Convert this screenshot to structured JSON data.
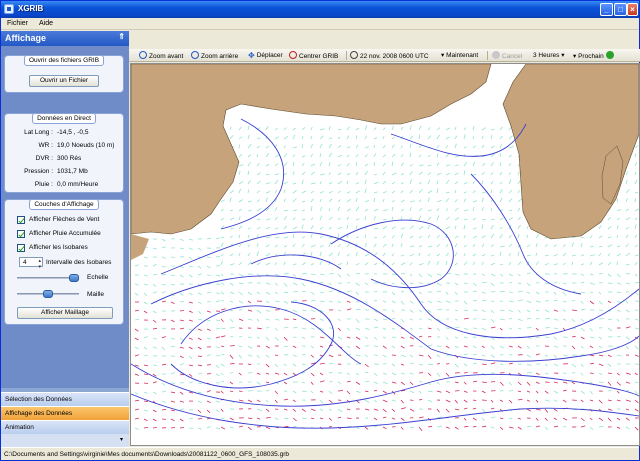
{
  "window": {
    "title": "XGRIB"
  },
  "menu": {
    "file": "Fichier",
    "help": "Aide"
  },
  "left_panel": {
    "title": "Affichage",
    "grib_group": {
      "title": "Ouvrir des fichiers GRIB",
      "open_button": "Ouvrir un Fichier"
    },
    "direct_group": {
      "title": "Données en Direct",
      "rows": [
        {
          "key": "Lat Long :",
          "value": "-14,5 , -0,5"
        },
        {
          "key": "WR :",
          "value": "19,0 Noeuds (10 m)"
        },
        {
          "key": "DVR :",
          "value": "300 Rés"
        },
        {
          "key": "Pression :",
          "value": "1031,7 Mb"
        },
        {
          "key": "Pluie :",
          "value": "0,0 mm/Heure"
        }
      ]
    },
    "layers_group": {
      "title": "Couches d'Affichage",
      "checkboxes": [
        "Afficher Flèches de Vent",
        "Afficher Pluie Accumulée",
        "Afficher les Isobares"
      ],
      "isobar_interval_value": "4",
      "isobar_interval_label": "Intervalle des Isobares",
      "scale_label": "Echelle",
      "scale_level": 0.95,
      "mesh_label": "Maille",
      "mesh_level": 0.5,
      "show_mesh_button": "Afficher Maillage"
    },
    "nav": [
      {
        "label": "Sélection des Données",
        "active": false
      },
      {
        "label": "Affichage des Données",
        "active": true
      },
      {
        "label": "Animation",
        "active": false
      }
    ]
  },
  "toolbar": {
    "zoom_in": "Zoom avant",
    "zoom_out": "Zoom arrière",
    "move": "Déplacer",
    "center": "Centrer GRIB",
    "datetime": "22 nov. 2008 0600 UTC",
    "now": "Maintenant",
    "prev": "Cancel",
    "step": "3 Heures",
    "next": "Prochain"
  },
  "status": {
    "path": "C:\\Documents and Settings\\virginie\\Mes documents\\Downloads\\20081122_0600_GFS_108035.grb"
  },
  "colors": {
    "land": "#c6a37a",
    "isobar": "#3a3fd0",
    "wind_light": "#8fe3d0",
    "wind_strong": "#d2285a",
    "accent": "#2458c6"
  }
}
